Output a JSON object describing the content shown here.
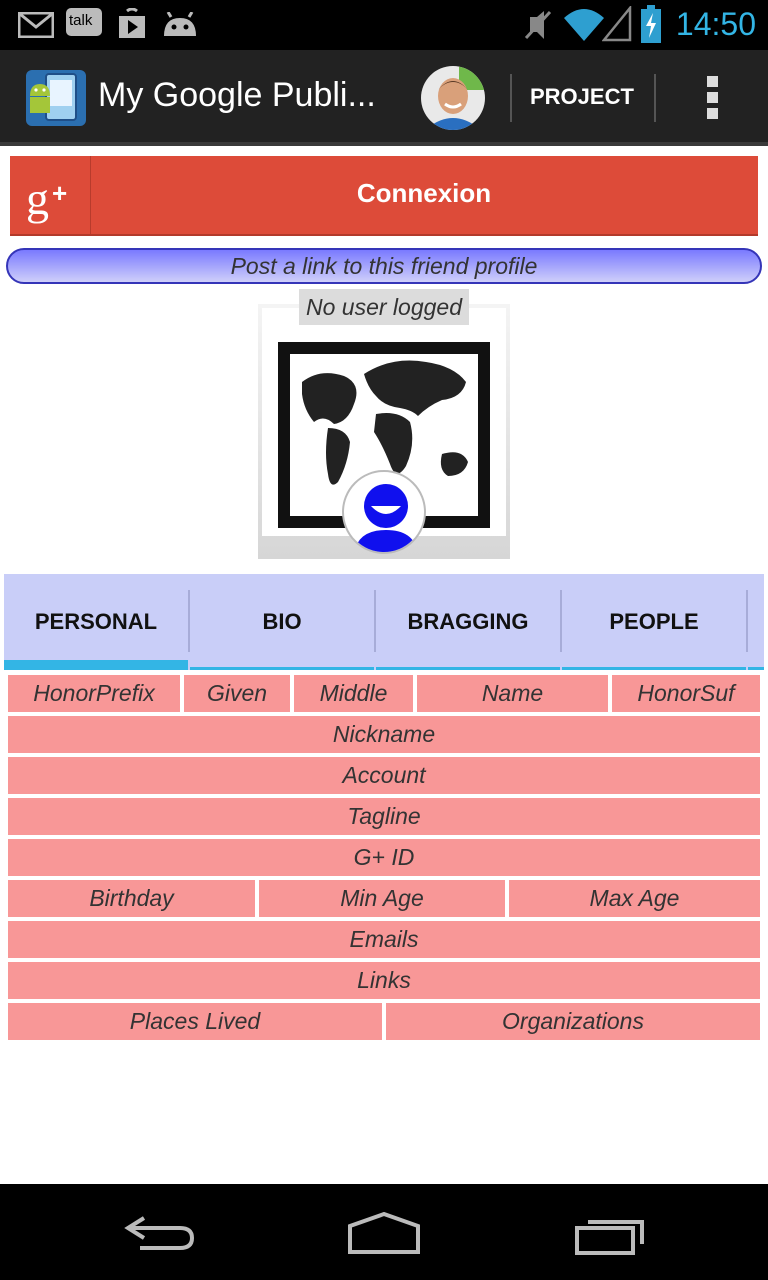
{
  "status_bar": {
    "time": "14:50",
    "talk_label": "talk",
    "left_icons": [
      "gmail-icon",
      "talk-icon",
      "play-store-icon",
      "android-icon"
    ],
    "right_icons": [
      "muted-icon",
      "wifi-icon",
      "signal-icon",
      "battery-icon"
    ]
  },
  "action_bar": {
    "title": "My Google Publi...",
    "project_label": "PROJECT"
  },
  "gplus_button": {
    "label": "Connexion"
  },
  "post_link": {
    "label": "Post a link to this friend profile"
  },
  "profile": {
    "no_user_label": "No user logged"
  },
  "tabs": [
    {
      "label": "PERSONAL",
      "selected": true
    },
    {
      "label": "BIO",
      "selected": false
    },
    {
      "label": "BRAGGING",
      "selected": false
    },
    {
      "label": "PEOPLE",
      "selected": false
    }
  ],
  "fields": {
    "honor_prefix": "HonorPrefix",
    "given": "Given",
    "middle": "Middle",
    "name": "Name",
    "honor_suffix": "HonorSuf",
    "nickname": "Nickname",
    "account": "Account",
    "tagline": "Tagline",
    "gplus_id": "G+ ID",
    "birthday": "Birthday",
    "min_age": "Min Age",
    "max_age": "Max Age",
    "emails": "Emails",
    "links": "Links",
    "places_lived": "Places Lived",
    "organizations": "Organizations"
  },
  "colors": {
    "accent": "#33b5e5",
    "gplus_red": "#dd4b39",
    "field_bg": "#f89797",
    "tab_bg": "#c9cef8"
  }
}
